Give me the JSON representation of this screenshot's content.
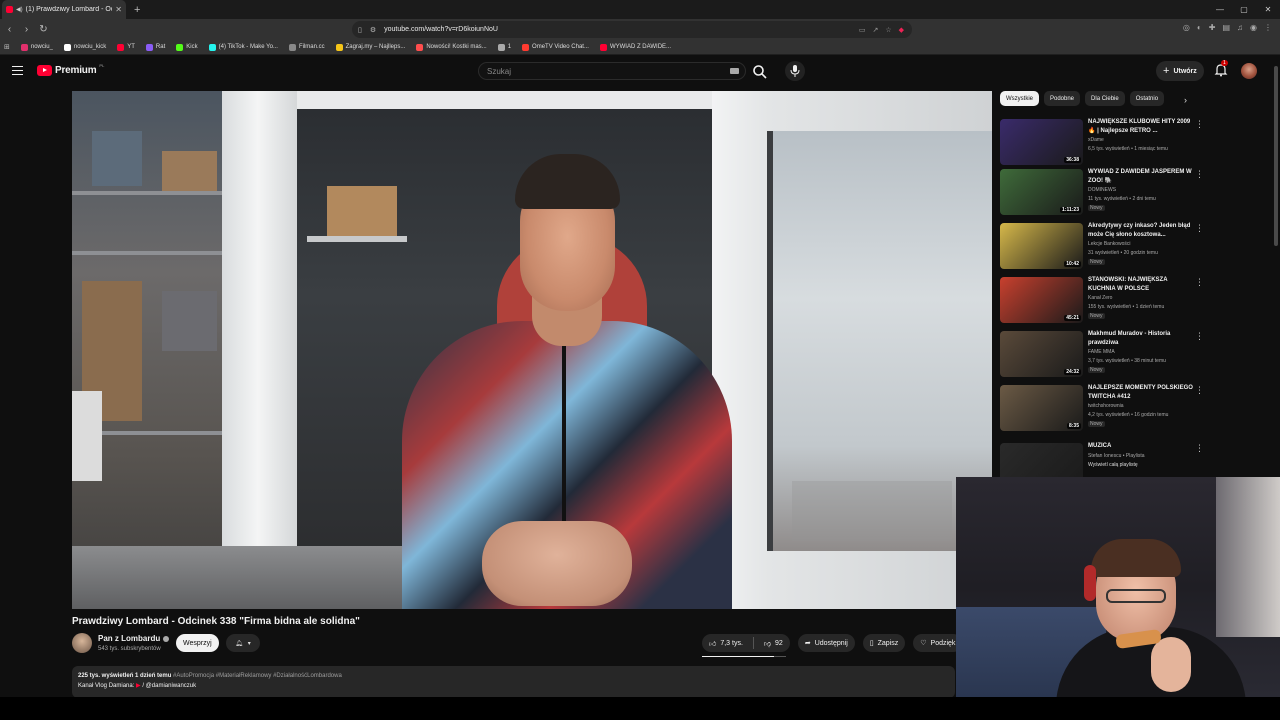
{
  "browser": {
    "tab_title": "(1) Prawdziwy Lombard - Odc",
    "url": "youtube.com/watch?v=rD6koiunNoU",
    "bookmarks": [
      {
        "label": "nowciu_",
        "color": "#e1306c"
      },
      {
        "label": "nowciu_kick",
        "color": "#ffffff"
      },
      {
        "label": "YT",
        "color": "#ff0033"
      },
      {
        "label": "Rat",
        "color": "#8a5cf6"
      },
      {
        "label": "Kick",
        "color": "#53fc18"
      },
      {
        "label": "(4) TikTok - Make Yo...",
        "color": "#25f4ee"
      },
      {
        "label": "Filman.cc",
        "color": "#888888"
      },
      {
        "label": "Zagraj.my – Najlleps...",
        "color": "#f5c518"
      },
      {
        "label": "Nowości! Kostki mas...",
        "color": "#ff4d4d"
      },
      {
        "label": "1",
        "color": "#aaaaaa"
      },
      {
        "label": "OmeTV Video Chat...",
        "color": "#ff3b30"
      },
      {
        "label": "WYWIAD Z DAWIDE...",
        "color": "#ff0033"
      }
    ]
  },
  "header": {
    "logo_text": "Premium",
    "logo_country": "PL",
    "search_placeholder": "Szukaj",
    "create_label": "Utwórz",
    "notification_count": "1"
  },
  "video": {
    "title": "Prawdziwy Lombard - Odcinek 338 \"Firma bidna ale solidna\"",
    "channel": "Pan z Lombardu",
    "subscribers": "543 tys. subskrybentów",
    "support_label": "Wesprzyj",
    "likes": "7,3 tys.",
    "like_ratio": 0.86,
    "dislikes": "92",
    "share_label": "Udostępnij",
    "save_label": "Zapisz",
    "thanks_label": "Podzięk",
    "views_date": "225 tys. wyświetleń  1 dzień temu",
    "hashtags": "#AutoPromocja #MateriałReklamowy #DziałalnośćLombardowa",
    "vlog_label": "Kanał Vlog Damiana:",
    "vlog_handle": "/ @damianiwanczuk"
  },
  "sidebar": {
    "chips": [
      "Wszystkie",
      "Podobne",
      "Dla Ciebie",
      "Ostatnio"
    ],
    "recommendations": [
      {
        "title": "NAJWIĘKSZE KLUBOWE HITY 2009 🔥 | Najlepsze RETRO ...",
        "channel": "xDame",
        "stats": "6,5 tys. wyświetleń • 1 miesiąc temu",
        "duration": "36:38",
        "badge": "",
        "thumb": "#3a2b6b"
      },
      {
        "title": "WYWIAD Z DAWIDEM JASPEREM W ZOO! 🐘",
        "channel": "DOMINEWS",
        "stats": "11 tys. wyświetleń • 2 dni temu",
        "duration": "1:11:23",
        "badge": "Nowy",
        "thumb": "#3f6b3a"
      },
      {
        "title": "Akredytywy czy inkaso? Jeden błąd może Cię słono kosztowa...",
        "channel": "Lekcje Bankowości",
        "stats": "31 wyświetleń • 20 godzin temu",
        "duration": "10:42",
        "badge": "Nowy",
        "thumb": "#d6b84a"
      },
      {
        "title": "STANOWSKI: NAJWIĘKSZA KUCHNIA W POLSCE",
        "channel": "Kanał Zero",
        "stats": "155 tys. wyświetleń • 1 dzień temu",
        "duration": "45:21",
        "badge": "Nowy",
        "thumb": "#c8402e"
      },
      {
        "title": "Makhmud Muradov - Historia prawdziwa",
        "channel": "FAME MMA",
        "stats": "3,7 tys. wyświetleń • 38 minut temu",
        "duration": "24:32",
        "badge": "Nowy",
        "thumb": "#5a4a3a"
      },
      {
        "title": "NAJLEPSZE MOMENTY POLSKIEGO TWITCHA #412",
        "channel": "twitchshorownia",
        "stats": "4,2 tys. wyświetleń • 16 godzin temu",
        "duration": "8:35",
        "badge": "Nowy",
        "thumb": "#6b5a45"
      },
      {
        "title": "MUZICĂ",
        "channel": "Stefan Ionescu • Playlista",
        "stats": "Wyświetl całą playlistę",
        "duration": "",
        "badge": "",
        "thumb": "#2a2a2a"
      }
    ]
  },
  "colors": {
    "accent": "#ff0033",
    "background": "#0f0f0f",
    "surface": "#272727"
  }
}
